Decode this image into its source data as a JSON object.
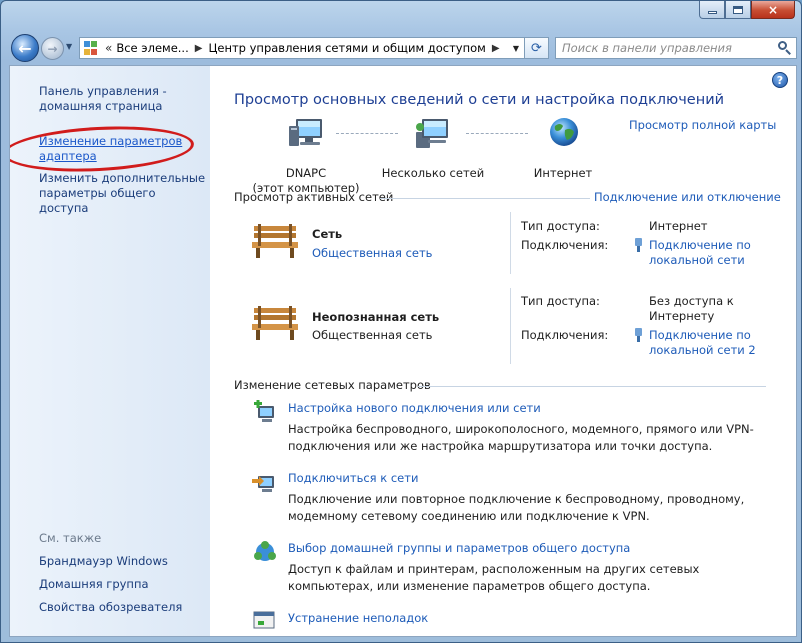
{
  "window": {
    "caption_min": "minimize",
    "caption_max": "maximize",
    "caption_close": "×"
  },
  "nav": {
    "back_icon": "back-arrow",
    "forward_icon": "forward-arrow",
    "address_chevron": "«",
    "breadcrumb": [
      "Все элеме...",
      "Центр управления сетями и общим доступом"
    ],
    "search_placeholder": "Поиск в панели управления"
  },
  "sidebar": {
    "home_link": "Панель управления - домашняя страница",
    "adapter_link": "Изменение параметров адаптера",
    "sharing_link": "Изменить дополнительные параметры общего доступа",
    "see_also_label": "См. также",
    "see_also": [
      "Брандмауэр Windows",
      "Домашняя группа",
      "Свойства обозревателя"
    ]
  },
  "main": {
    "title": "Просмотр основных сведений о сети и настройка подключений",
    "full_map_link": "Просмотр полной карты",
    "map": {
      "computer_name": "DNAPC",
      "computer_sub": "(этот компьютер)",
      "middle": "Несколько сетей",
      "internet": "Интернет"
    },
    "active_networks_label": "Просмотр активных сетей",
    "connect_link": "Подключение или отключение",
    "networks": [
      {
        "name": "Сеть",
        "type": "Общественная сеть",
        "type_is_link": true,
        "access_label": "Тип доступа:",
        "access_value": "Интернет",
        "conn_label": "Подключения:",
        "conn_value": "Подключение по локальной сети"
      },
      {
        "name": "Неопознанная сеть",
        "type": "Общественная сеть",
        "type_is_link": false,
        "access_label": "Тип доступа:",
        "access_value": "Без доступа к Интернету",
        "conn_label": "Подключения:",
        "conn_value": "Подключение по локальной сети 2"
      }
    ],
    "change_settings_label": "Изменение сетевых параметров",
    "tasks": [
      {
        "title": "Настройка нового подключения или сети",
        "desc": "Настройка беспроводного, широкополосного, модемного, прямого или VPN-подключения или же настройка маршрутизатора или точки доступа.",
        "icon": "new-connection-icon"
      },
      {
        "title": "Подключиться к сети",
        "desc": "Подключение или повторное подключение к беспроводному, проводному, модемному сетевому соединению или подключение к VPN.",
        "icon": "connect-network-icon"
      },
      {
        "title": "Выбор домашней группы и параметров общего доступа",
        "desc": "Доступ к файлам и принтерам, расположенным на других сетевых компьютерах, или изменение параметров общего доступа.",
        "icon": "homegroup-icon"
      },
      {
        "title": "Устранение неполадок",
        "desc": "",
        "icon": "troubleshoot-icon"
      }
    ]
  },
  "colors": {
    "link": "#1d5bb8",
    "title": "#1e3f94",
    "annotation": "#d11c1c"
  }
}
